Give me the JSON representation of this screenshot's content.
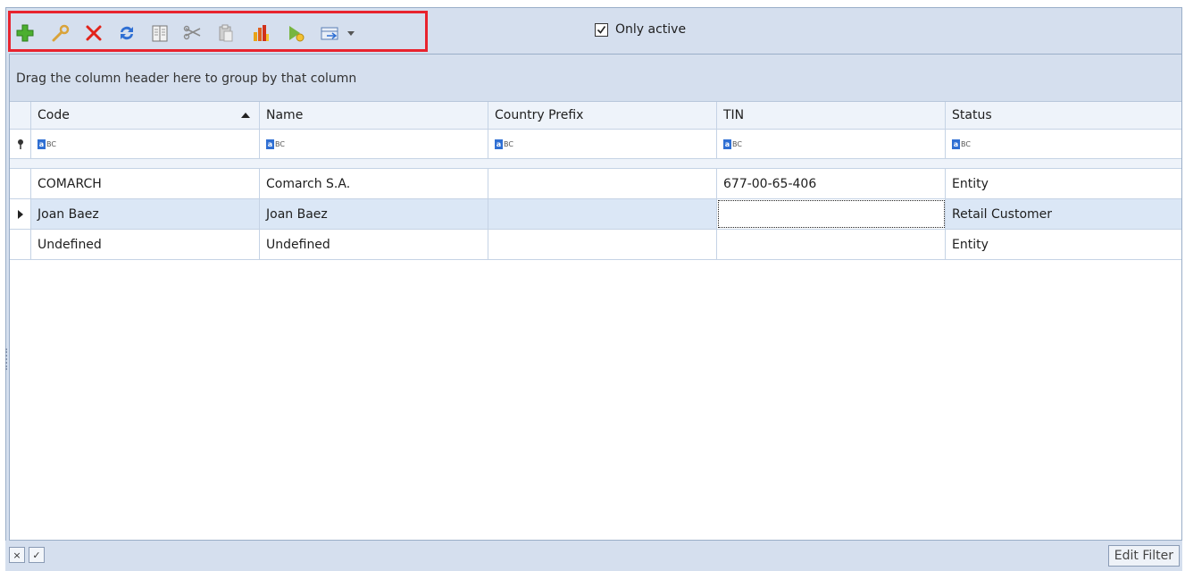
{
  "toolbar": {
    "icons": [
      "add-icon",
      "edit-icon",
      "delete-icon",
      "refresh-icon",
      "view-icon",
      "cut-icon",
      "paste-icon",
      "chart-icon",
      "run-icon",
      "export-icon",
      "dropdown-icon"
    ],
    "only_active_label": "Only active",
    "only_active_checked": true
  },
  "grid": {
    "group_panel_text": "Drag the column header here to group by that column",
    "columns": [
      "Code",
      "Name",
      "Country Prefix",
      "TIN",
      "Status"
    ],
    "sort_column": "Code",
    "filter_icon_text": "BC",
    "rows": [
      {
        "code": "COMARCH",
        "name": "Comarch S.A.",
        "country_prefix": "",
        "tin": "677-00-65-406",
        "status": "Entity"
      },
      {
        "code": "Joan Baez",
        "name": "Joan Baez",
        "country_prefix": "",
        "tin": "",
        "status": "Retail Customer"
      },
      {
        "code": "Undefined",
        "name": "Undefined",
        "country_prefix": "",
        "tin": "",
        "status": "Entity"
      }
    ],
    "selected_row": 1
  },
  "statusbar": {
    "close_glyph": "×",
    "check_glyph": "✓",
    "edit_filter_label": "Edit Filter"
  },
  "colors": {
    "frame_bg": "#d5dfee",
    "highlight_border": "#e8232e",
    "selected_row": "#dbe7f6"
  }
}
